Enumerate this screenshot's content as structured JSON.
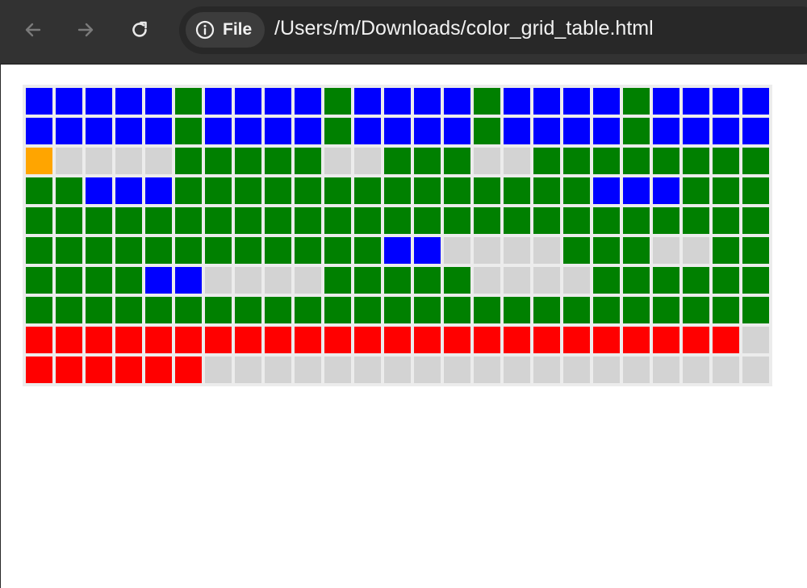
{
  "browser": {
    "chip_label": "File",
    "url": "/Users/m/Downloads/color_grid_table.html"
  },
  "colors": {
    "B": "#0000ff",
    "G": "#008000",
    "R": "#ff0000",
    "O": "#ffa500",
    "L": "#d3d3d3"
  },
  "grid": {
    "rows": [
      [
        "B",
        "B",
        "B",
        "B",
        "B",
        "G",
        "B",
        "B",
        "B",
        "B",
        "G",
        "B",
        "B",
        "B",
        "B",
        "G",
        "B",
        "B",
        "B",
        "B",
        "G",
        "B",
        "B",
        "B",
        "B"
      ],
      [
        "B",
        "B",
        "B",
        "B",
        "B",
        "G",
        "B",
        "B",
        "B",
        "B",
        "G",
        "B",
        "B",
        "B",
        "B",
        "G",
        "B",
        "B",
        "B",
        "B",
        "G",
        "B",
        "B",
        "B",
        "B"
      ],
      [
        "O",
        "L",
        "L",
        "L",
        "L",
        "G",
        "G",
        "G",
        "G",
        "G",
        "L",
        "L",
        "G",
        "G",
        "G",
        "L",
        "L",
        "G",
        "G",
        "G",
        "G",
        "G",
        "G",
        "G",
        "G"
      ],
      [
        "G",
        "G",
        "B",
        "B",
        "B",
        "G",
        "G",
        "G",
        "G",
        "G",
        "G",
        "G",
        "G",
        "G",
        "G",
        "G",
        "G",
        "G",
        "G",
        "B",
        "B",
        "B",
        "G",
        "G",
        "G"
      ],
      [
        "G",
        "G",
        "G",
        "G",
        "G",
        "G",
        "G",
        "G",
        "G",
        "G",
        "G",
        "G",
        "G",
        "G",
        "G",
        "G",
        "G",
        "G",
        "G",
        "G",
        "G",
        "G",
        "G",
        "G",
        "G"
      ],
      [
        "G",
        "G",
        "G",
        "G",
        "G",
        "G",
        "G",
        "G",
        "G",
        "G",
        "G",
        "G",
        "B",
        "B",
        "L",
        "L",
        "L",
        "L",
        "G",
        "G",
        "G",
        "L",
        "L",
        "G",
        "G"
      ],
      [
        "G",
        "G",
        "G",
        "G",
        "B",
        "B",
        "L",
        "L",
        "L",
        "L",
        "G",
        "G",
        "G",
        "G",
        "G",
        "L",
        "L",
        "L",
        "L",
        "G",
        "G",
        "G",
        "G",
        "G",
        "G"
      ],
      [
        "G",
        "G",
        "G",
        "G",
        "G",
        "G",
        "G",
        "G",
        "G",
        "G",
        "G",
        "G",
        "G",
        "G",
        "G",
        "G",
        "G",
        "G",
        "G",
        "G",
        "G",
        "G",
        "G",
        "G",
        "G"
      ],
      [
        "R",
        "R",
        "R",
        "R",
        "R",
        "R",
        "R",
        "R",
        "R",
        "R",
        "R",
        "R",
        "R",
        "R",
        "R",
        "R",
        "R",
        "R",
        "R",
        "R",
        "R",
        "R",
        "R",
        "R",
        "L"
      ],
      [
        "R",
        "R",
        "R",
        "R",
        "R",
        "R",
        "L",
        "L",
        "L",
        "L",
        "L",
        "L",
        "L",
        "L",
        "L",
        "L",
        "L",
        "L",
        "L",
        "L",
        "L",
        "L",
        "L",
        "L",
        "L"
      ]
    ]
  }
}
